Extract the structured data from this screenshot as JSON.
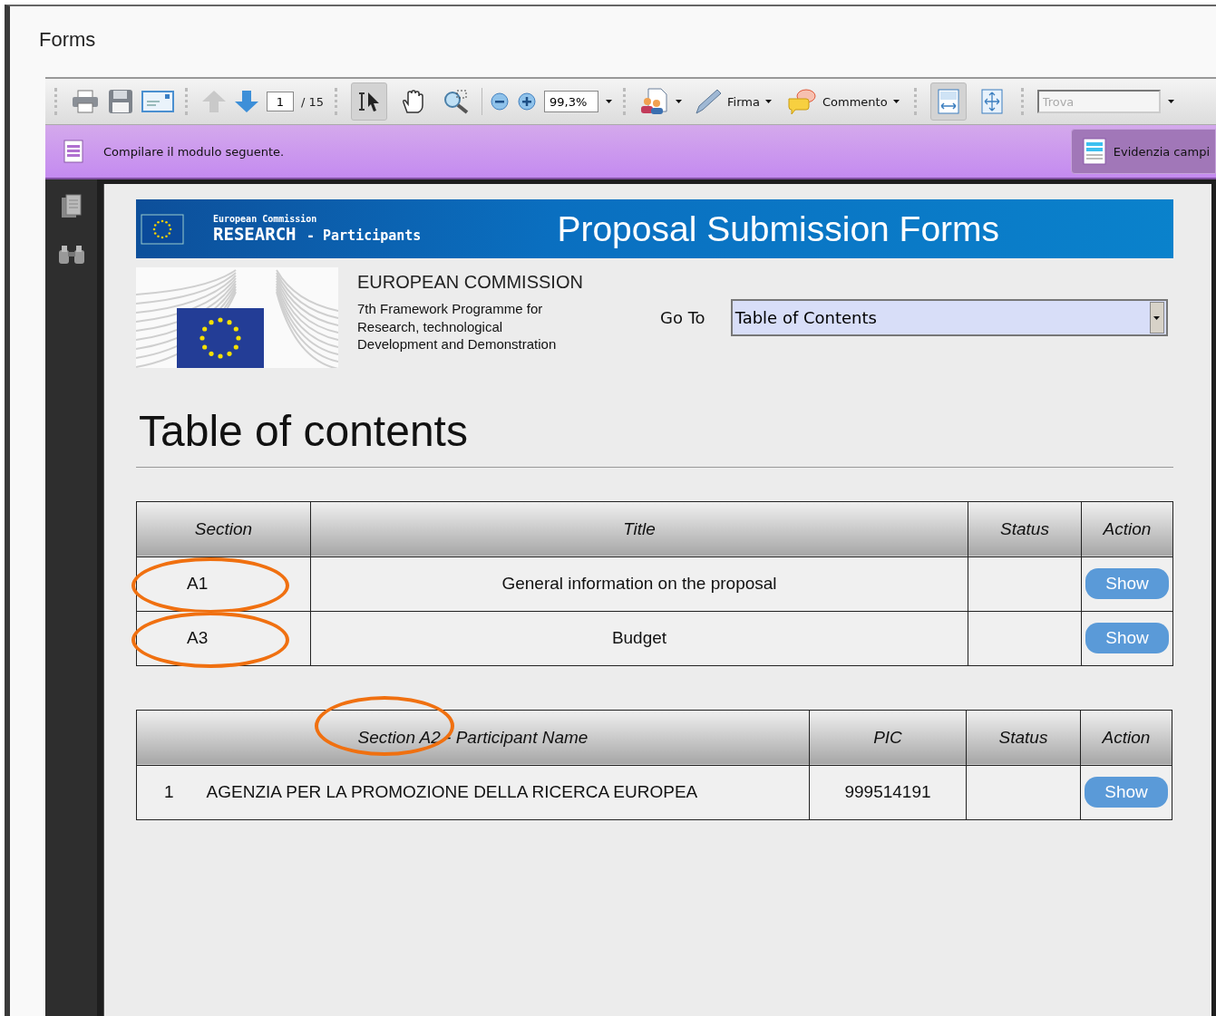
{
  "window": {
    "title": "Forms"
  },
  "toolbar": {
    "page_number": "1",
    "page_total": "/ 15",
    "zoom": "99,3%",
    "sign_label": "Firma",
    "comment_label": "Commento",
    "search_placeholder": "Trova",
    "tools": [
      {
        "kind": "select",
        "selected": true
      },
      {
        "kind": "hand",
        "selected": false
      },
      {
        "kind": "zoom",
        "selected": false
      }
    ],
    "views": [
      {
        "kind": "fit-width",
        "selected": true
      },
      {
        "kind": "fit-page",
        "selected": false
      }
    ]
  },
  "form_bar": {
    "message": "Compilare il modulo seguente.",
    "highlight_button": "Evidenzia campi"
  },
  "document": {
    "banner": {
      "org": "European Commission",
      "program": "RESEARCH",
      "suffix": "- Participants",
      "title": "Proposal Submission Forms"
    },
    "commission": "EUROPEAN COMMISSION",
    "programme_lines": [
      "7th Framework Programme for",
      "Research, technological",
      "Development and Demonstration"
    ],
    "goto": {
      "label": "Go To",
      "value": "Table of Contents"
    },
    "heading": "Table of contents",
    "sections_table": {
      "columns": [
        "Section",
        "Title",
        "Status",
        "Action"
      ],
      "rows": [
        {
          "section": "A1",
          "title": "General information on the proposal",
          "action": "Show",
          "circled": true
        },
        {
          "section": "A3",
          "title": "Budget",
          "action": "Show",
          "circled": true
        }
      ]
    },
    "participants_table": {
      "columns": [
        "Section A2 - Participant Name",
        "PIC",
        "Status",
        "Action"
      ],
      "header_circled": true,
      "rows": [
        {
          "number": "1",
          "name": "AGENZIA PER LA PROMOZIONE DELLA RICERCA EUROPEA",
          "pic": "999514191",
          "action": "Show"
        }
      ]
    }
  }
}
